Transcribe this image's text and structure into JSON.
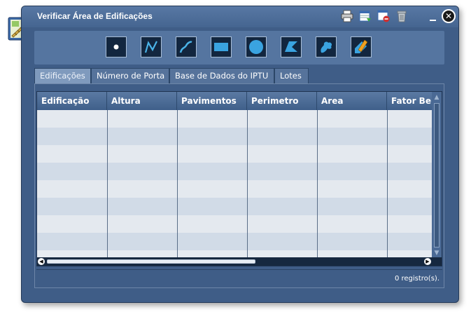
{
  "window": {
    "title": "Verificar Área de Edificações",
    "title_icons": [
      "printer-icon",
      "export-table-icon",
      "remove-layer-icon",
      "trash-icon"
    ],
    "close_label": "✕"
  },
  "draw_tools": [
    {
      "name": "point-tool"
    },
    {
      "name": "polyline-tool"
    },
    {
      "name": "freehand-line-tool"
    },
    {
      "name": "rectangle-tool"
    },
    {
      "name": "circle-tool"
    },
    {
      "name": "polygon-tool"
    },
    {
      "name": "freehand-polygon-tool"
    },
    {
      "name": "edit-tool"
    }
  ],
  "tabs": [
    {
      "label": "Edificações",
      "active": true
    },
    {
      "label": "Número de Porta",
      "active": false
    },
    {
      "label": "Base de Dados do IPTU",
      "active": false
    },
    {
      "label": "Lotes",
      "active": false
    }
  ],
  "table": {
    "columns": [
      "Edificação",
      "Altura",
      "Pavimentos",
      "Perimetro",
      "Area",
      "Fator Beriarmento"
    ],
    "rows": []
  },
  "status": {
    "record_count": "0 registro(s)."
  },
  "colors": {
    "window_bg": "#3f5d87",
    "header_bg": "#4a6a96",
    "row_even": "#e4e9ef",
    "row_odd": "#d1dbe7"
  }
}
